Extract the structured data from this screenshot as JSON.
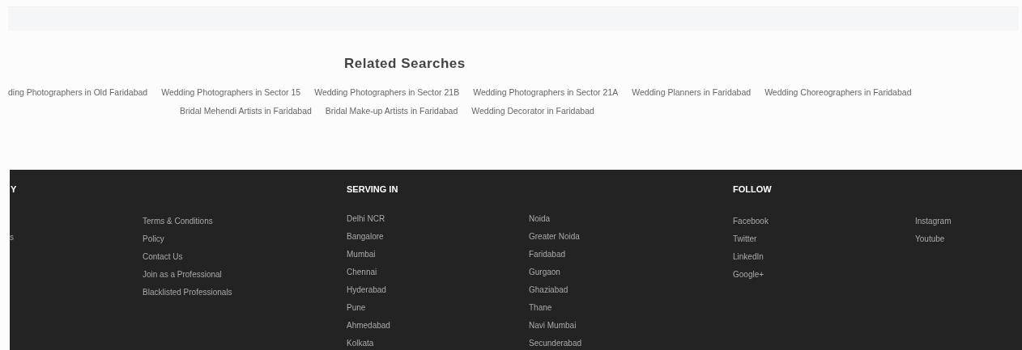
{
  "related_searches": {
    "title": "Related Searches",
    "lines": [
      {
        "links": [
          "ding Photographers in Old Faridabad",
          "Wedding Photographers in Sector 15",
          "Wedding Photographers in Sector 21B",
          "Wedding Photographers in Sector 21A",
          "Wedding Planners in Faridabad",
          "Wedding Choreographers in Faridabad"
        ]
      },
      {
        "links": [
          "Bridal Mehendi Artists in Faridabad",
          "Bridal Make-up Artists in Faridabad",
          "Wedding Decorator in Faridabad"
        ]
      }
    ]
  },
  "footer": {
    "sections": [
      {
        "heading": "Y",
        "columns": [
          [
            "s"
          ],
          [
            "Terms & Conditions",
            "Policy",
            "Contact Us",
            "Join as a Professional",
            "Blacklisted Professionals"
          ]
        ]
      },
      {
        "heading": "SERVING IN",
        "columns": [
          [
            "Delhi NCR",
            "Bangalore",
            "Mumbai",
            "Chennai",
            "Hyderabad",
            "Pune",
            "Ahmedabad",
            "Kolkata"
          ],
          [
            "Noida",
            "Greater Noida",
            "Faridabad",
            "Gurgaon",
            "Ghaziabad",
            "Thane",
            "Navi Mumbai",
            "Secunderabad"
          ]
        ]
      },
      {
        "heading": "FOLLOW",
        "columns": [
          [
            "Facebook",
            "Twitter",
            "LinkedIn",
            "Google+"
          ],
          [
            "Instagram",
            "Youtube"
          ]
        ]
      }
    ]
  }
}
